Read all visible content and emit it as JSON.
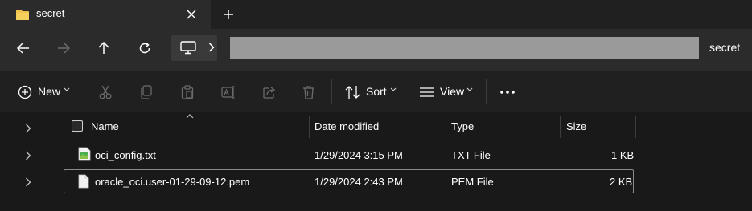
{
  "tab": {
    "title": "secret"
  },
  "address": {
    "current_folder": "secret"
  },
  "commandbar": {
    "new_label": "New",
    "sort_label": "Sort",
    "view_label": "View"
  },
  "columns": {
    "name": "Name",
    "date_modified": "Date modified",
    "type": "Type",
    "size": "Size"
  },
  "files": [
    {
      "name": "oci_config.txt",
      "date": "1/29/2024 3:15 PM",
      "type": "TXT File",
      "size": "1 KB",
      "icon": "text-file-icon"
    },
    {
      "name": "oracle_oci.user-01-29-09-12.pem",
      "date": "1/29/2024 2:43 PM",
      "type": "PEM File",
      "size": "2 KB",
      "icon": "document-icon",
      "selected": true
    }
  ],
  "colors": {
    "accent_folder": "#f0c24b",
    "background": "#1c1c1c",
    "address_redaction": "#9a9a9a"
  }
}
